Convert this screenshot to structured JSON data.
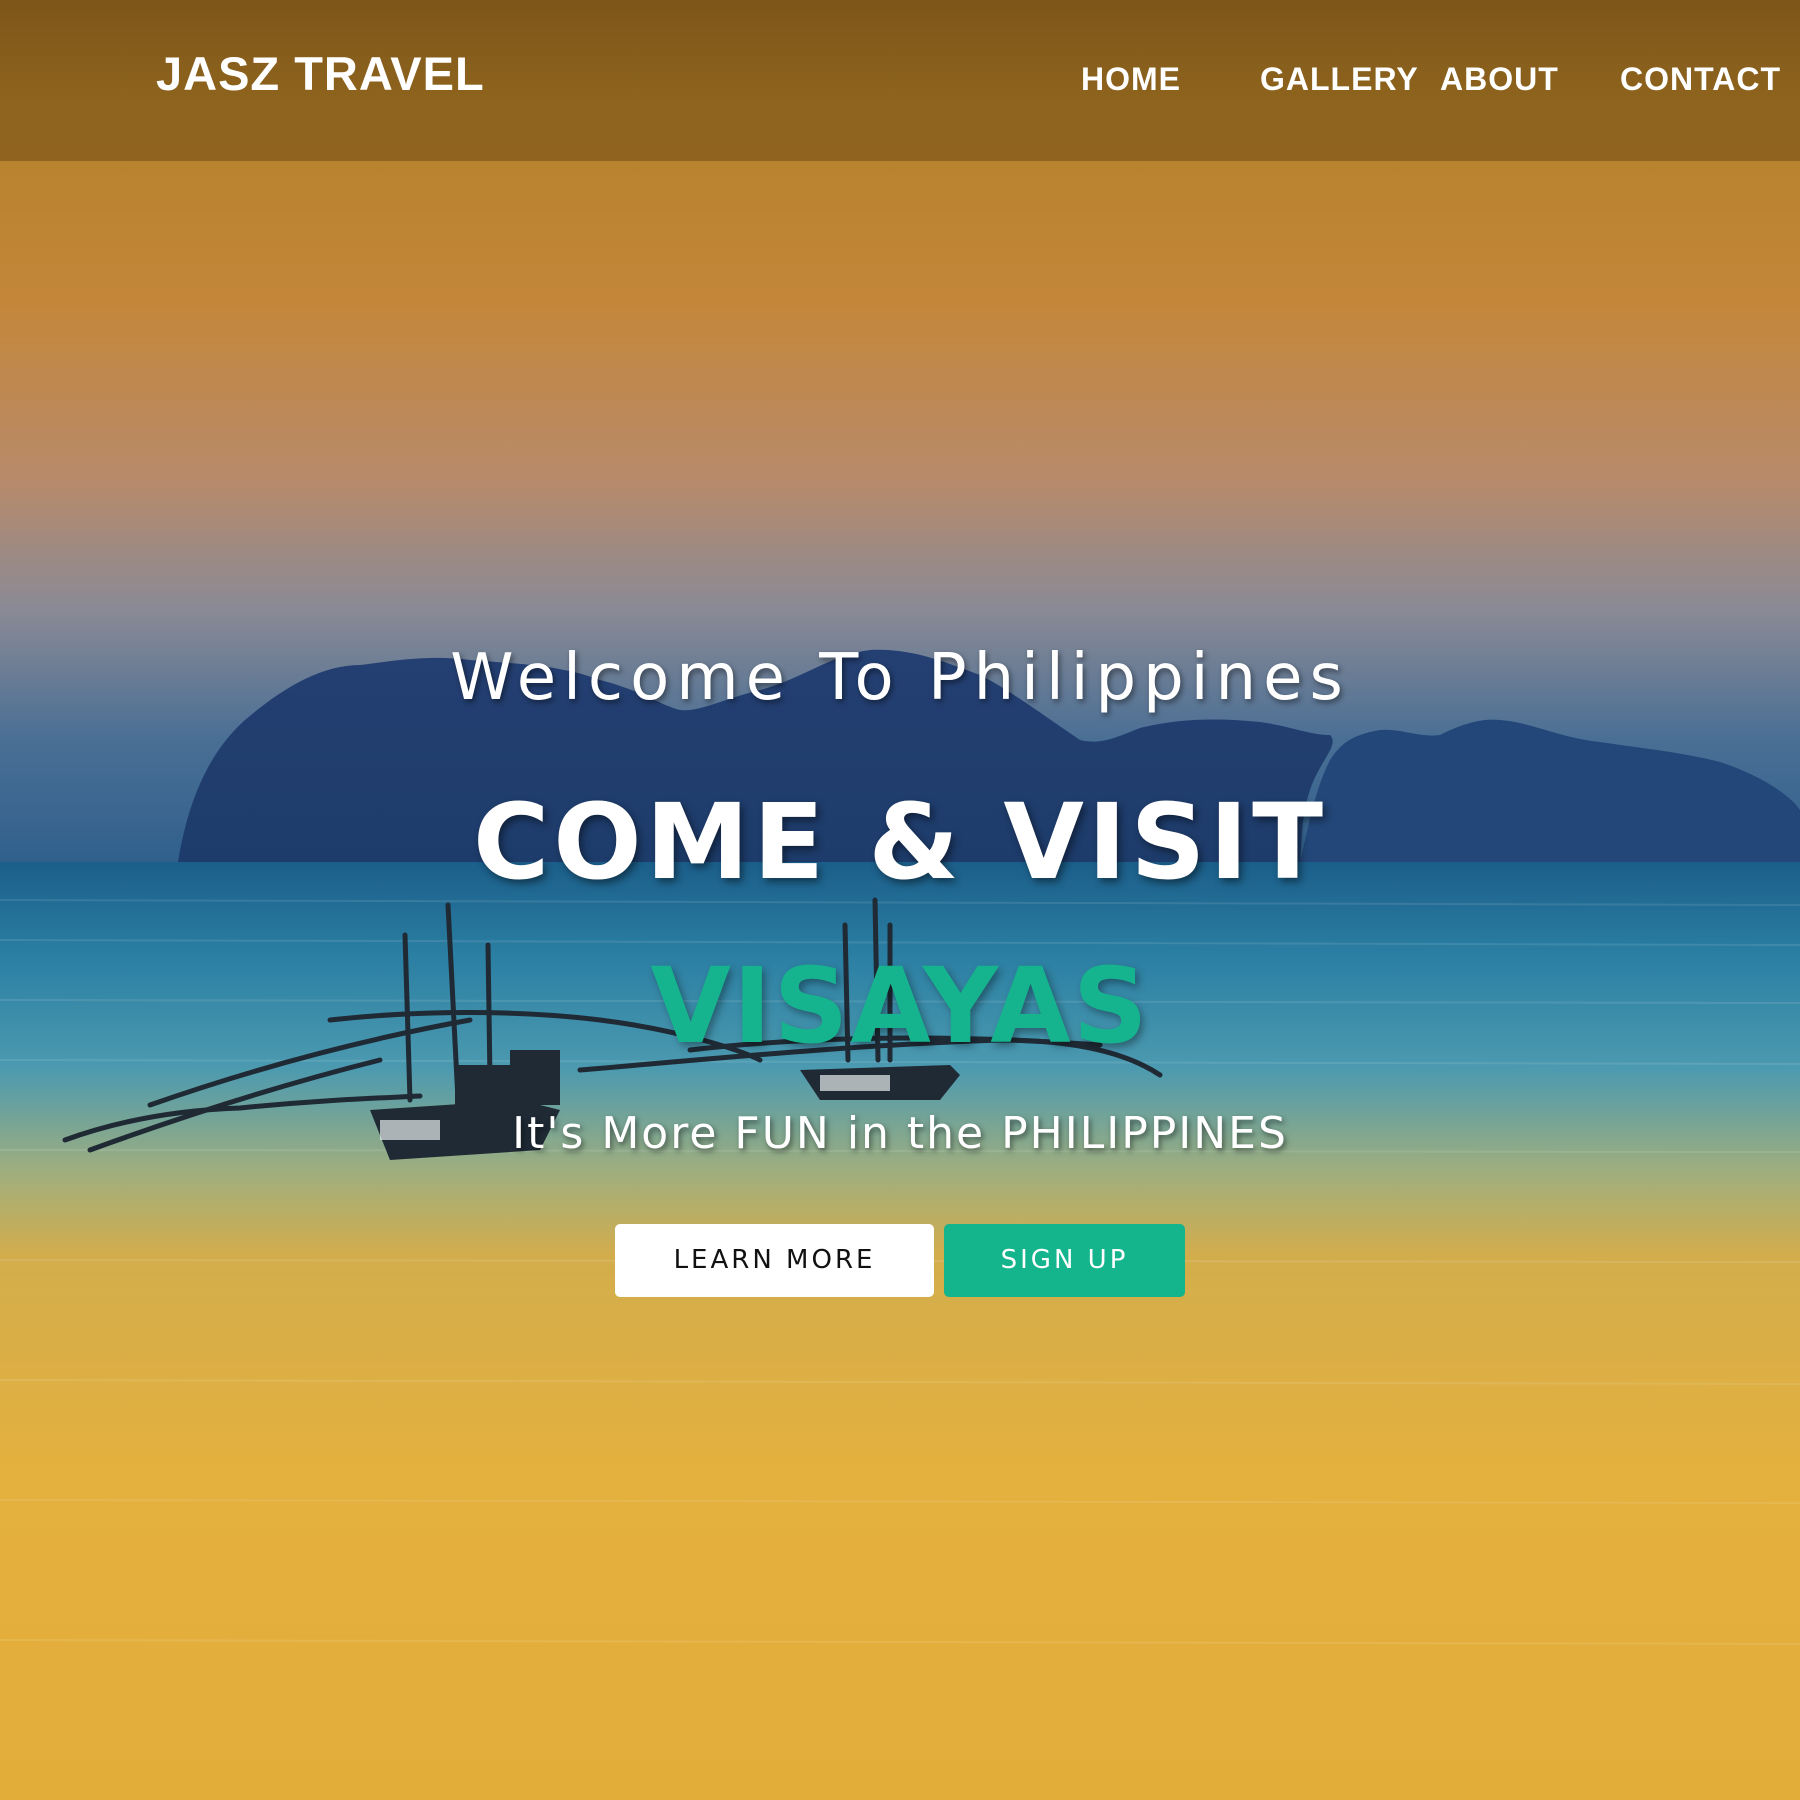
{
  "header": {
    "brand": "JASZ TRAVEL",
    "nav": [
      {
        "label": "HOME"
      },
      {
        "label": "GALLERY"
      },
      {
        "label": "ABOUT"
      },
      {
        "label": "CONTACT"
      }
    ]
  },
  "hero": {
    "welcome": "Welcome To Philippines",
    "headline": "COME & VISIT",
    "destination": "VISAYAS",
    "tagline": "It's More FUN in the PHILIPPINES",
    "buttons": {
      "learn_more": "LEARN MORE",
      "sign_up": "SIGN UP"
    }
  },
  "colors": {
    "accent": "#14b48d",
    "navbar": "#7a5417",
    "text": "#ffffff"
  }
}
